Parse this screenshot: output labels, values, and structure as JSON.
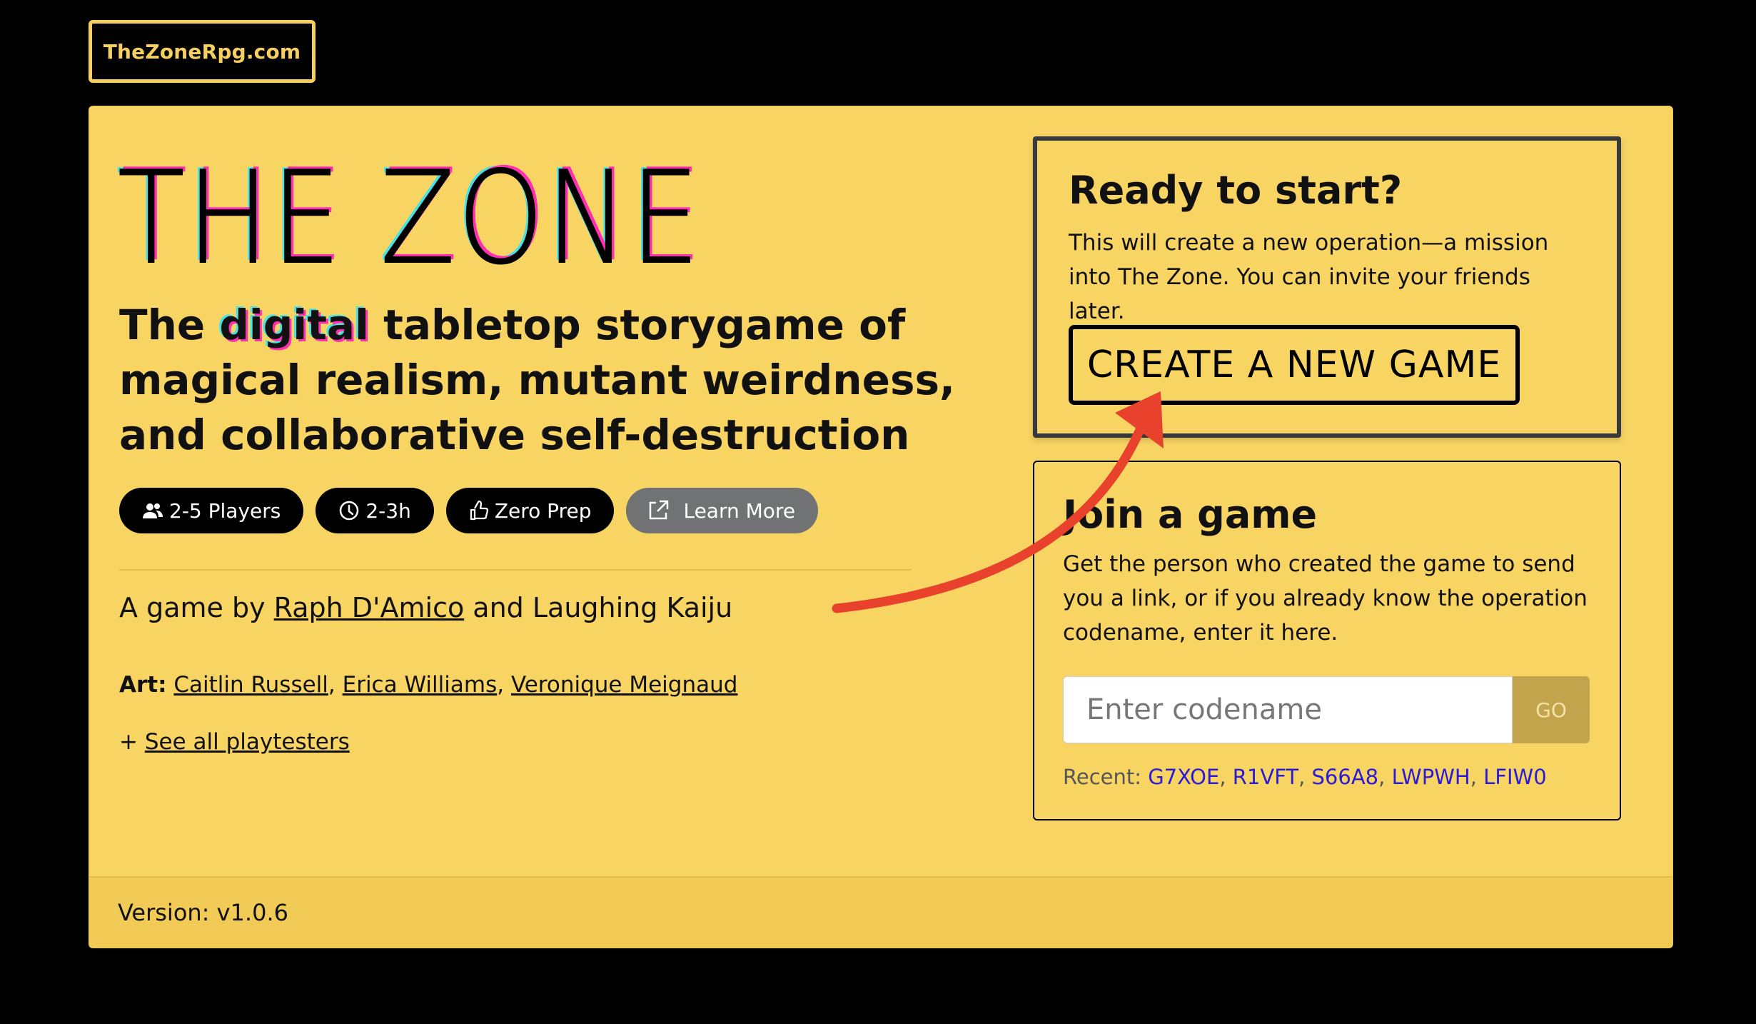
{
  "site_link": "TheZoneRpg.com",
  "hero": {
    "title": "THE ZONE",
    "tagline_pre": "The ",
    "tagline_glitch": "digital",
    "tagline_post": " tabletop storygame of magical realism, mutant weirdness, and collaborative self-destruction"
  },
  "pills": [
    {
      "icon": "users-icon",
      "label": "2-5 Players"
    },
    {
      "icon": "clock-icon",
      "label": "2-3h"
    },
    {
      "icon": "thumbs-up-icon",
      "label": "Zero Prep"
    },
    {
      "icon": "external-link-icon",
      "label": "Learn More"
    }
  ],
  "byline": {
    "prefix": "A game by ",
    "author": "Raph D'Amico",
    "suffix": " and Laughing Kaiju"
  },
  "art": {
    "label": "Art:",
    "artists": [
      "Caitlin Russell",
      "Erica Williams",
      "Veronique Meignaud"
    ]
  },
  "playtesters": {
    "prefix": "+ ",
    "link": "See all playtesters"
  },
  "ready": {
    "heading": "Ready to start?",
    "text": "This will create a new operation—a mission into The Zone. You can invite your friends later.",
    "button": "CREATE A NEW GAME"
  },
  "join": {
    "heading": "Join a game",
    "text": "Get the person who created the game to send you a link, or if you already know the operation codename, enter it here.",
    "input_placeholder": "Enter codename",
    "go_label": "GO",
    "recent_label": "Recent:",
    "recent_codes": [
      "G7XOE",
      "R1VFT",
      "S66A8",
      "LWPWH",
      "LFIW0"
    ]
  },
  "footer": {
    "version": "Version: v1.0.6"
  },
  "colors": {
    "background": "#000000",
    "card": "#f8d463",
    "accent_pink": "#ff2fb3",
    "accent_cyan": "#45e3e8",
    "link_blue": "#2b1bd6",
    "arrow_red": "#e8412c"
  }
}
